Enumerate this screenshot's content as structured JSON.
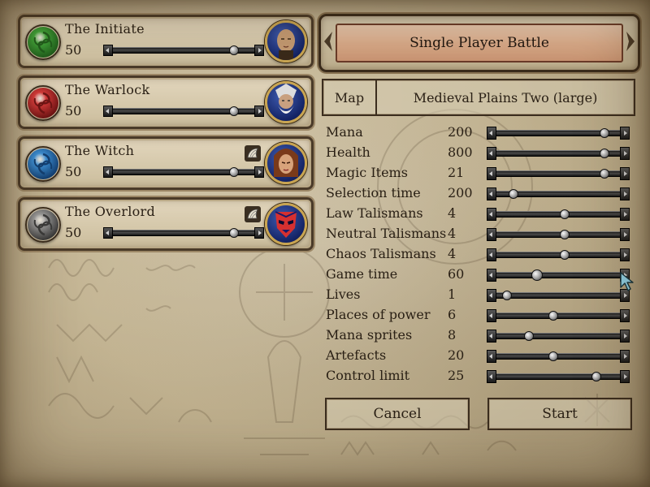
{
  "title": "Single Player Battle",
  "players": [
    {
      "name": "The Initiate",
      "value": "50",
      "slider": 0.86,
      "orb_color": "#3fa83a",
      "orb_dark": "#1f5e1c",
      "portrait_icon": "bald-mage-portrait-icon",
      "has_shell": false
    },
    {
      "name": "The Warlock",
      "value": "50",
      "slider": 0.86,
      "orb_color": "#d83a3a",
      "orb_dark": "#6e1414",
      "portrait_icon": "bearded-wizard-portrait-icon",
      "has_shell": false
    },
    {
      "name": "The Witch",
      "value": "50",
      "slider": 0.86,
      "orb_color": "#3b8fd6",
      "orb_dark": "#123f72",
      "portrait_icon": "witch-portrait-icon",
      "has_shell": true
    },
    {
      "name": "The Overlord",
      "value": "50",
      "slider": 0.86,
      "orb_color": "#9a9a9a",
      "orb_dark": "#3a3a3a",
      "portrait_icon": "masked-overlord-portrait-icon",
      "has_shell": true
    }
  ],
  "map": {
    "label": "Map",
    "value": "Medieval Plains Two (large)"
  },
  "settings": [
    {
      "label": "Mana",
      "value": "200",
      "slider": 0.88
    },
    {
      "label": "Health",
      "value": "800",
      "slider": 0.88
    },
    {
      "label": "Magic Items",
      "value": "21",
      "slider": 0.88
    },
    {
      "label": "Selection time",
      "value": "200",
      "slider": 0.12
    },
    {
      "label": "Law Talismans",
      "value": "4",
      "slider": 0.55
    },
    {
      "label": "Neutral Talismans",
      "value": "4",
      "slider": 0.55
    },
    {
      "label": "Chaos Talismans",
      "value": "4",
      "slider": 0.55
    },
    {
      "label": "Game time",
      "value": "60",
      "slider": 0.32
    },
    {
      "label": "Lives",
      "value": "1",
      "slider": 0.07
    },
    {
      "label": "Places of power",
      "value": "6",
      "slider": 0.45
    },
    {
      "label": "Mana sprites",
      "value": "8",
      "slider": 0.25
    },
    {
      "label": "Artefacts",
      "value": "20",
      "slider": 0.45
    },
    {
      "label": "Control limit",
      "value": "25",
      "slider": 0.81
    }
  ],
  "buttons": {
    "cancel": "Cancel",
    "start": "Start"
  },
  "colors": {
    "text": "#2a2015",
    "frame": "#3b2d1e",
    "title_fill": "#d9ab8a",
    "portrait_bg": "#1c2e7a",
    "portrait_ring": "#c9a552"
  }
}
